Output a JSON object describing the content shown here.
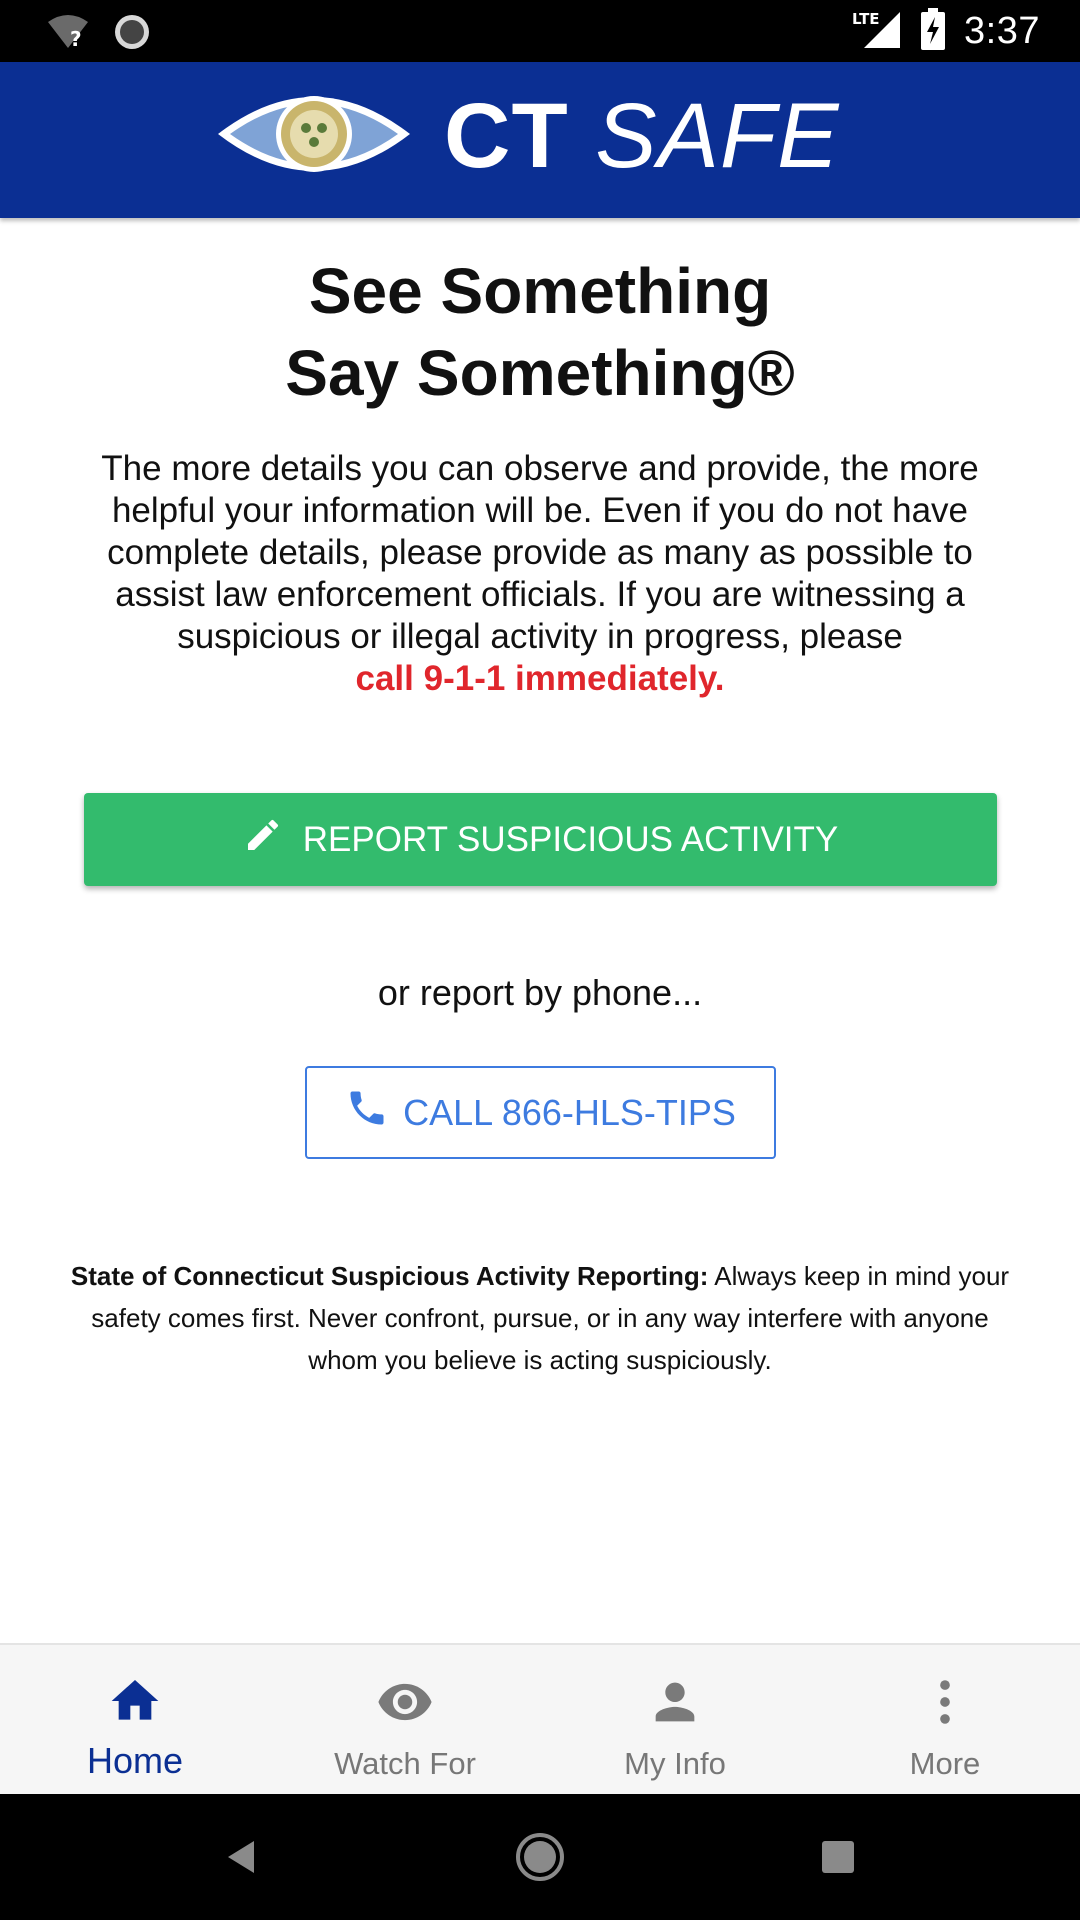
{
  "status_bar": {
    "time": "3:37",
    "network": "LTE",
    "icons": [
      "wifi-question-icon",
      "sync-icon",
      "lte-signal-icon",
      "battery-charging-icon"
    ]
  },
  "header": {
    "logo_text_ct": "CT",
    "logo_text_safe": "SAFE",
    "brand_color": "#0b2f93"
  },
  "main": {
    "headline_line1": "See Something",
    "headline_line2": "Say Something®",
    "body": "The more details you can observe and provide, the more helpful your information will be. Even if you do not have complete details, please provide as many as possible to assist law enforcement officials. If you are witnessing a suspicious or illegal activity in progress, please",
    "warning": "call 9-1-1 immediately.",
    "report_button": "REPORT SUSPICIOUS ACTIVITY",
    "or_phone": "or report by phone...",
    "call_button": "CALL 866-HLS-TIPS",
    "disclaimer_title": "State of Connecticut Suspicious Activity Reporting:",
    "disclaimer_body": " Always keep in mind your safety comes first. Never confront, pursue, or in any way interfere with anyone whom you believe is acting suspiciously."
  },
  "colors": {
    "report_green": "#33bb6d",
    "call_blue": "#3d7be0",
    "warning_red": "#e0262c"
  },
  "bottom_nav": {
    "items": [
      {
        "label": "Home",
        "icon": "home-icon",
        "active": true
      },
      {
        "label": "Watch For",
        "icon": "eye-icon",
        "active": false
      },
      {
        "label": "My Info",
        "icon": "person-icon",
        "active": false
      },
      {
        "label": "More",
        "icon": "more-vertical-icon",
        "active": false
      }
    ]
  },
  "system_nav": {
    "icons": [
      "back-icon",
      "home-circle-icon",
      "recents-icon"
    ]
  }
}
